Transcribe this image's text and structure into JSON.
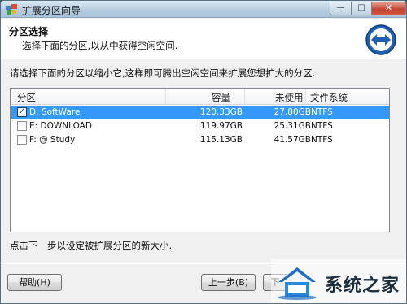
{
  "window": {
    "title": "扩展分区向导",
    "controls": {
      "minimize": "—",
      "maximize": "□",
      "close": "✕"
    }
  },
  "header": {
    "title": "分区选择",
    "subtitle": "选择下面的分区,以从中获得空闲空间."
  },
  "instruction": "请选择下面的分区以缩小它,这样即可腾出空闲空间来扩展您想扩大的分区.",
  "list": {
    "columns": [
      "分区",
      "容量",
      "未使用",
      "文件系统"
    ],
    "rows": [
      {
        "name": "D: SoftWare",
        "capacity": "120.33GB",
        "free": "27.80GB",
        "fs": "NTFS",
        "checked": true,
        "selected": true
      },
      {
        "name": "E: DOWNLOAD",
        "capacity": "119.97GB",
        "free": "25.31GB",
        "fs": "NTFS",
        "checked": false,
        "selected": false
      },
      {
        "name": "F: @ Study",
        "capacity": "115.13GB",
        "free": "41.57GB",
        "fs": "NTFS",
        "checked": false,
        "selected": false
      }
    ]
  },
  "hint": "点击下一步以设定被扩展分区的新大小.",
  "buttons": {
    "help": "帮助(H)",
    "prev": "上一步(B)",
    "next": "下"
  },
  "watermark": {
    "text": "系统之家"
  },
  "colors": {
    "selection": "#3399ff",
    "logo_blue": "#1f5fb3"
  }
}
